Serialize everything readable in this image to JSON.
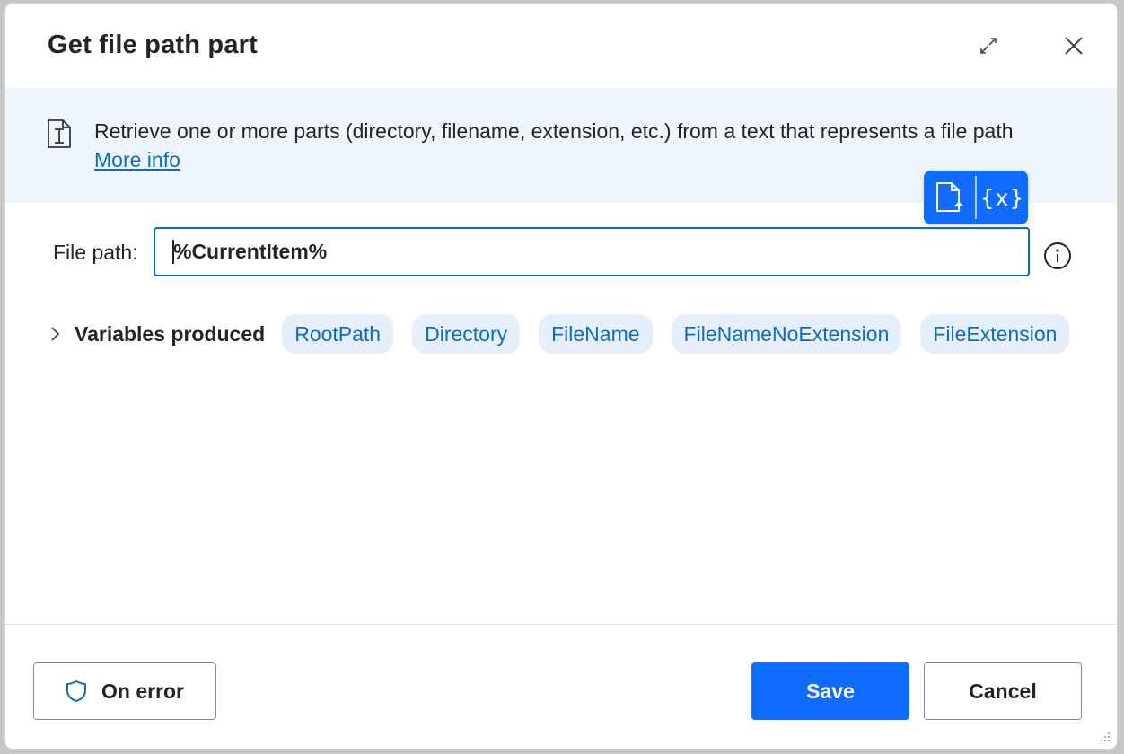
{
  "dialog": {
    "title": "Get file path part"
  },
  "banner": {
    "description": "Retrieve one or more parts (directory, filename, extension, etc.) from a text that represents a file path",
    "link_label": "More info"
  },
  "popup": {
    "variables_glyph": "{x}"
  },
  "file_path": {
    "label": "File path:",
    "value": "%CurrentItem%"
  },
  "variables": {
    "label": "Variables produced",
    "chips": [
      "RootPath",
      "Directory",
      "FileName",
      "FileNameNoExtension",
      "FileExtension"
    ]
  },
  "footer": {
    "on_error_label": "On error",
    "save_label": "Save",
    "cancel_label": "Cancel"
  },
  "colors": {
    "accent": "#0f6cff",
    "link": "#0f6cbd",
    "banner_bg": "#eff5fd",
    "chip_bg": "#e6effc"
  }
}
